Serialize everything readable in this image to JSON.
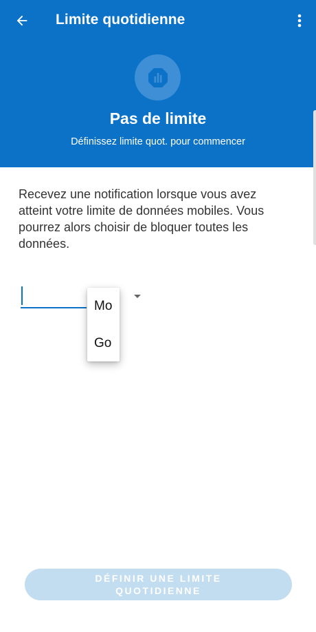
{
  "toolbar": {
    "title": "Limite quotidienne",
    "back_icon": "arrow-left-icon",
    "more_icon": "more-vertical-icon"
  },
  "hero": {
    "icon": "data-usage-icon",
    "title": "Pas de limite",
    "subtitle": "Définissez limite quot. pour commencer"
  },
  "main": {
    "description": "Recevez une notification lorsque vous avez atteint votre limite de données mobiles. Vous pourrez alors choisir de bloquer toutes les données.",
    "limit_input": {
      "value": ""
    },
    "unit_menu": {
      "options": [
        "Mo",
        "Go"
      ]
    }
  },
  "footer": {
    "button_label": "DÉFINIR UNE LIMITE QUOTIDIENNE"
  },
  "colors": {
    "primary": "#0b72c7",
    "primary_light": "#3e8fd6",
    "button_disabled": "#c2dcf0"
  }
}
